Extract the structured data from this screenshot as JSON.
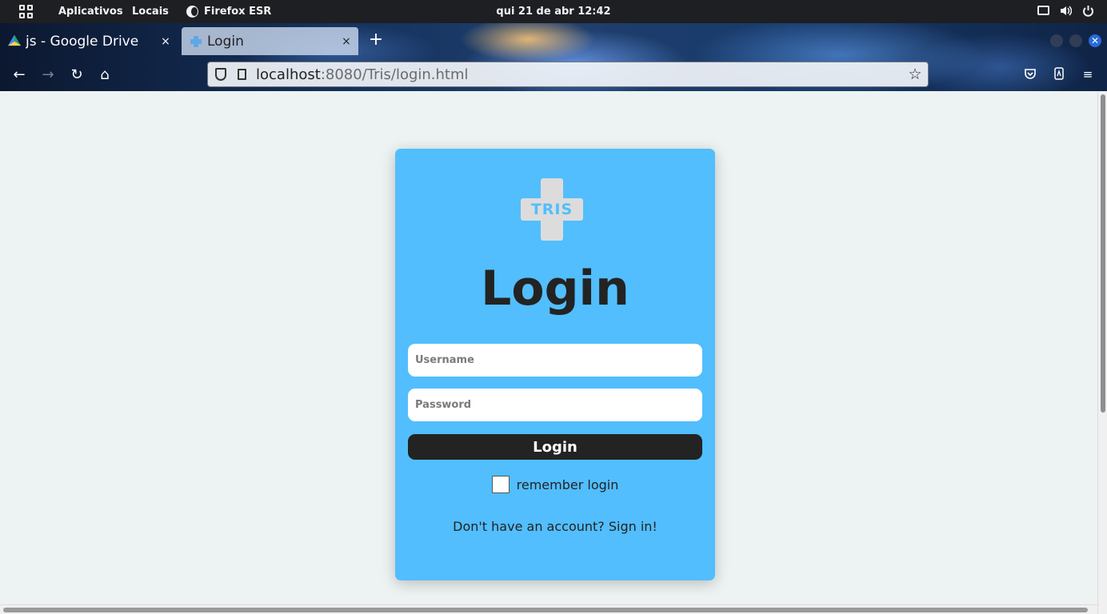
{
  "system_bar": {
    "apps_label": "Aplicativos",
    "places_label": "Locais",
    "active_app": "Firefox ESR",
    "clock": "qui 21 de abr  12:42"
  },
  "browser": {
    "tabs": [
      {
        "title": "js - Google Drive",
        "close": "×"
      },
      {
        "title": "Login",
        "close": "×"
      }
    ],
    "new_tab": "+",
    "url_host": "localhost",
    "url_rest": ":8080/Tris/login.html"
  },
  "page": {
    "logo_text": "TRIS",
    "heading": "Login",
    "username_placeholder": "Username",
    "password_placeholder": "Password",
    "login_button": "Login",
    "remember_label": "remember login",
    "signup_text": "Don't have an account? Sign in!"
  },
  "colors": {
    "card_background": "#52befd",
    "page_background": "#edf3f2",
    "button_background": "#232323",
    "logo_cross": "#dcdcdc"
  }
}
